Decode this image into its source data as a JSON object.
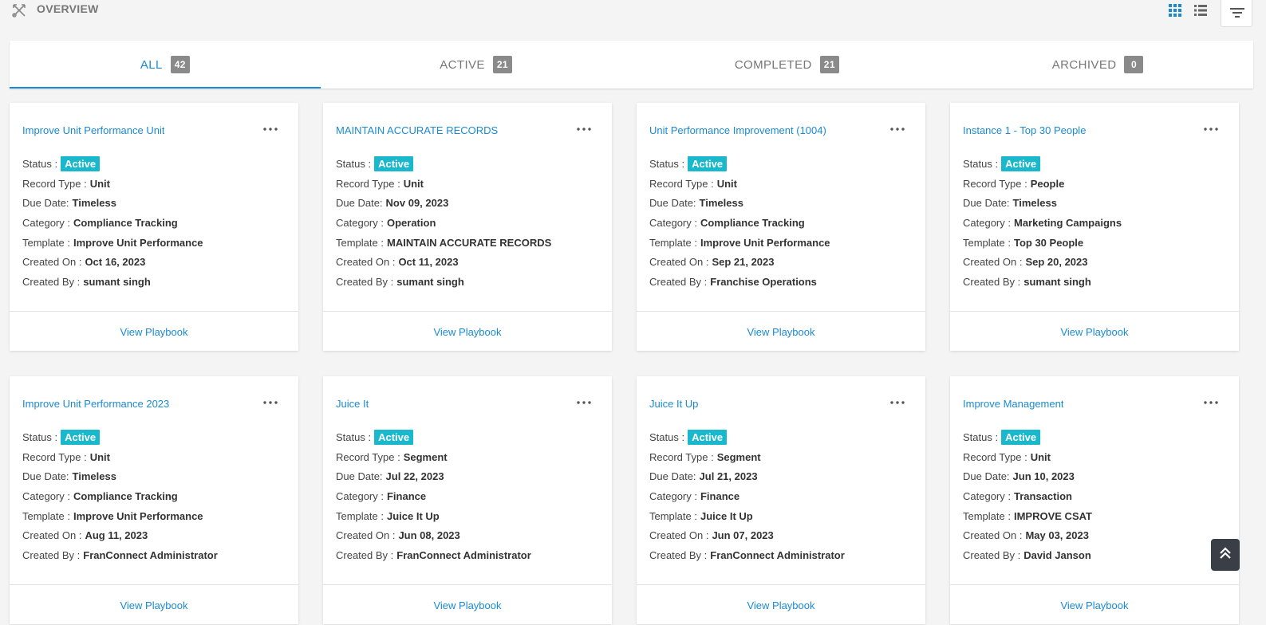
{
  "header": {
    "title": "OVERVIEW",
    "icons": [
      "crossed-arrows-icon",
      "grid-view-icon",
      "list-view-icon",
      "filter-icon"
    ]
  },
  "tabs": [
    {
      "label": "ALL",
      "count": "42",
      "active": true
    },
    {
      "label": "ACTIVE",
      "count": "21",
      "active": false
    },
    {
      "label": "COMPLETED",
      "count": "21",
      "active": false
    },
    {
      "label": "ARCHIVED",
      "count": "0",
      "active": false
    }
  ],
  "labels": {
    "status": "Status :",
    "record_type": "Record Type :",
    "due_date": "Due Date:",
    "category": "Category :",
    "template": "Template :",
    "created_on": "Created On :",
    "created_by": "Created By :",
    "view_playbook": "View Playbook"
  },
  "cards": [
    {
      "title": "Improve Unit Performance Unit",
      "status": "Active",
      "record_type": "Unit",
      "due_date": "Timeless",
      "category": "Compliance Tracking",
      "template": "Improve Unit Performance",
      "created_on": "Oct 16, 2023",
      "created_by": "sumant singh"
    },
    {
      "title": "MAINTAIN ACCURATE RECORDS",
      "status": "Active",
      "record_type": "Unit",
      "due_date": "Nov 09, 2023",
      "category": "Operation",
      "template": "MAINTAIN ACCURATE RECORDS",
      "created_on": "Oct 11, 2023",
      "created_by": "sumant singh"
    },
    {
      "title": "Unit Performance Improvement (1004)",
      "status": "Active",
      "record_type": "Unit",
      "due_date": "Timeless",
      "category": "Compliance Tracking",
      "template": "Improve Unit Performance",
      "created_on": "Sep 21, 2023",
      "created_by": "Franchise Operations"
    },
    {
      "title": "Instance 1 - Top 30 People",
      "status": "Active",
      "record_type": "People",
      "due_date": "Timeless",
      "category": "Marketing Campaigns",
      "template": "Top 30 People",
      "created_on": "Sep 20, 2023",
      "created_by": "sumant singh"
    },
    {
      "title": "Improve Unit Performance 2023",
      "status": "Active",
      "record_type": "Unit",
      "due_date": "Timeless",
      "category": "Compliance Tracking",
      "template": "Improve Unit Performance",
      "created_on": "Aug 11, 2023",
      "created_by": "FranConnect Administrator"
    },
    {
      "title": "Juice It",
      "status": "Active",
      "record_type": "Segment",
      "due_date": "Jul 22, 2023",
      "category": "Finance",
      "template": "Juice It Up",
      "created_on": "Jun 08, 2023",
      "created_by": "FranConnect Administrator"
    },
    {
      "title": "Juice It Up",
      "status": "Active",
      "record_type": "Segment",
      "due_date": "Jul 21, 2023",
      "category": "Finance",
      "template": "Juice It Up",
      "created_on": "Jun 07, 2023",
      "created_by": "FranConnect Administrator"
    },
    {
      "title": "Improve Management",
      "status": "Active",
      "record_type": "Unit",
      "due_date": "Jun 10, 2023",
      "category": "Transaction",
      "template": "IMPROVE CSAT",
      "created_on": "May 03, 2023",
      "created_by": "David Janson"
    }
  ],
  "colors": {
    "accent": "#1a8ad4",
    "status_active": "#1ab8cc",
    "count_badge": "#8a8a8a"
  }
}
